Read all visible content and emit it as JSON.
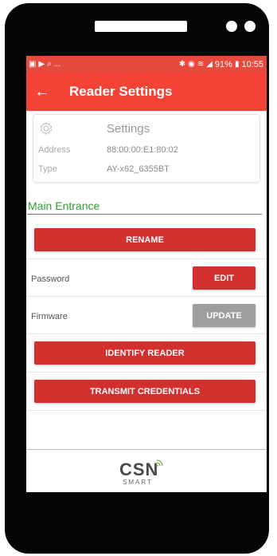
{
  "status_bar": {
    "left_icons": [
      "image-icon",
      "play-icon",
      "tag-icon",
      "more-icon"
    ],
    "left_ellipsis": "...",
    "battery": "91%",
    "time": "10:55",
    "right_icons": [
      "bluetooth-icon",
      "no-disturb-icon",
      "wifi-icon",
      "signal-icon",
      "battery-icon"
    ]
  },
  "app_bar": {
    "title": "Reader Settings",
    "back_icon": "arrow-left-icon"
  },
  "settings_card": {
    "title": "Settings",
    "icon": "gear-icon",
    "address_label": "Address",
    "address_value": "88:00:00:E1:80:02",
    "type_label": "Type",
    "type_value": "AY-x62_6355BT"
  },
  "reader_name": "Main Entrance",
  "actions": {
    "rename": "RENAME",
    "password_label": "Password",
    "edit": "EDIT",
    "firmware_label": "Firmware",
    "update": "UPDATE",
    "identify": "IDENTIFY READER",
    "transmit": "TRANSMIT CREDENTIALS"
  },
  "footer": {
    "logo_text": "CSN",
    "logo_sub": "SMART"
  },
  "colors": {
    "status_bar": "#e64a3d",
    "app_bar": "#f44336",
    "button": "#d32f2f",
    "button_disabled": "#9e9e9e",
    "reader_name": "#2d9d2d",
    "logo_accent": "#7cb342"
  }
}
